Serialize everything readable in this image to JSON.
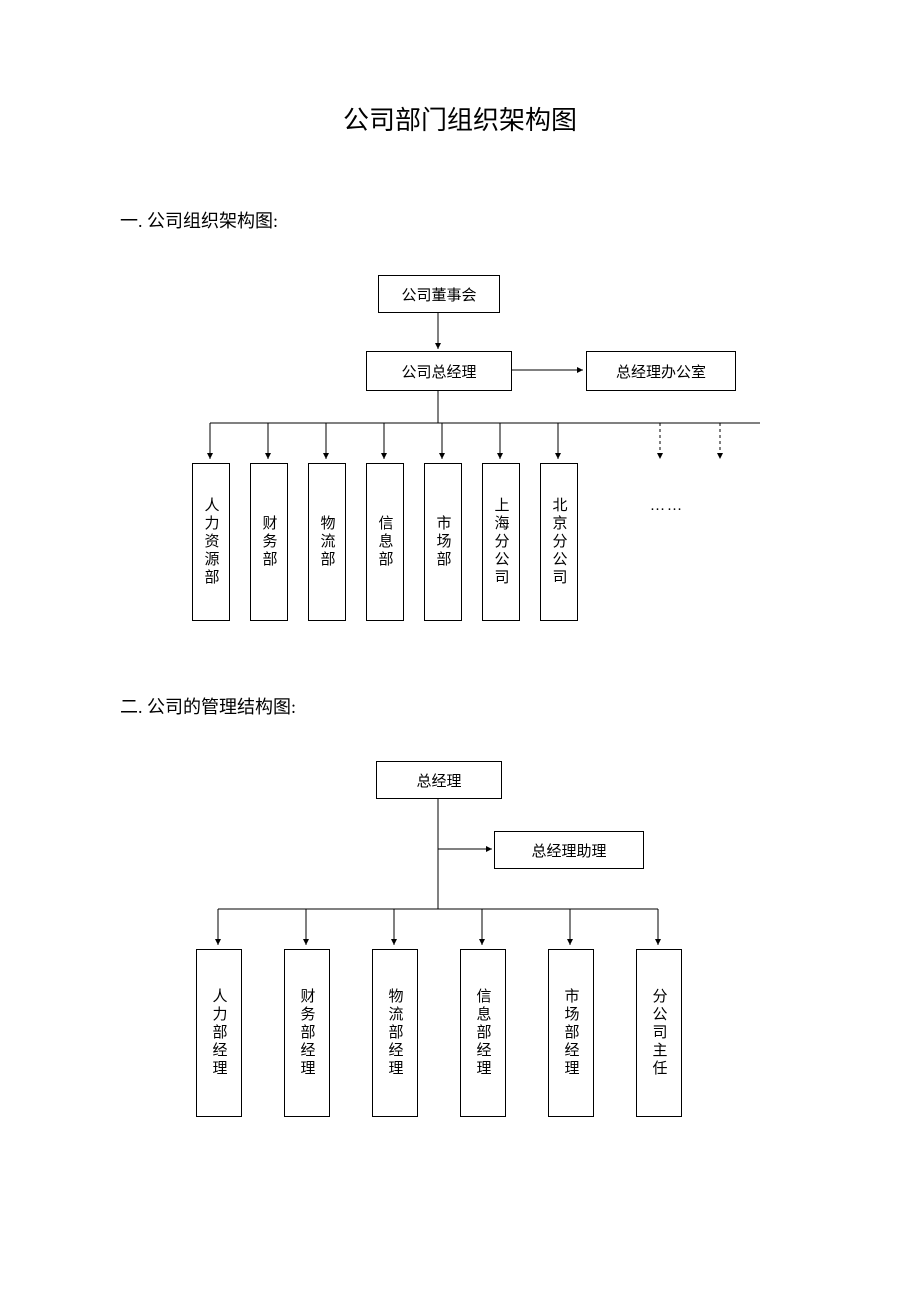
{
  "title": "公司部门组织架构图",
  "section1_heading": "一. 公司组织架构图:",
  "section2_heading": "二. 公司的管理结构图:",
  "chart1": {
    "top": "公司董事会",
    "mid": "公司总经理",
    "side": "总经理办公室",
    "depts": [
      "人力资源部",
      "财务部",
      "物流部",
      "信息部",
      "市场部",
      "上海分公司",
      "北京分公司"
    ],
    "ellipsis": "……"
  },
  "chart2": {
    "top": "总经理",
    "side": "总经理助理",
    "mgrs": [
      "人力部经理",
      "财务部经理",
      "物流部经理",
      "信息部经理",
      "市场部经理",
      "分公司主任"
    ]
  },
  "chart_data": [
    {
      "type": "org-tree",
      "title": "公司组织架构图",
      "root": "公司董事会",
      "edges": [
        {
          "from": "公司董事会",
          "to": "公司总经理",
          "style": "solid"
        },
        {
          "from": "公司总经理",
          "to": "总经理办公室",
          "style": "solid",
          "direction": "right"
        },
        {
          "from": "公司总经理",
          "to": "人力资源部",
          "style": "solid"
        },
        {
          "from": "公司总经理",
          "to": "财务部",
          "style": "solid"
        },
        {
          "from": "公司总经理",
          "to": "物流部",
          "style": "solid"
        },
        {
          "from": "公司总经理",
          "to": "信息部",
          "style": "solid"
        },
        {
          "from": "公司总经理",
          "to": "市场部",
          "style": "solid"
        },
        {
          "from": "公司总经理",
          "to": "上海分公司",
          "style": "solid"
        },
        {
          "from": "公司总经理",
          "to": "北京分公司",
          "style": "solid"
        },
        {
          "from": "公司总经理",
          "to": "(更多)",
          "style": "dashed"
        }
      ]
    },
    {
      "type": "org-tree",
      "title": "公司的管理结构图",
      "root": "总经理",
      "edges": [
        {
          "from": "总经理",
          "to": "总经理助理",
          "style": "solid",
          "direction": "right"
        },
        {
          "from": "总经理",
          "to": "人力部经理",
          "style": "solid"
        },
        {
          "from": "总经理",
          "to": "财务部经理",
          "style": "solid"
        },
        {
          "from": "总经理",
          "to": "物流部经理",
          "style": "solid"
        },
        {
          "from": "总经理",
          "to": "信息部经理",
          "style": "solid"
        },
        {
          "from": "总经理",
          "to": "市场部经理",
          "style": "solid"
        },
        {
          "from": "总经理",
          "to": "分公司主任",
          "style": "solid"
        }
      ]
    }
  ]
}
